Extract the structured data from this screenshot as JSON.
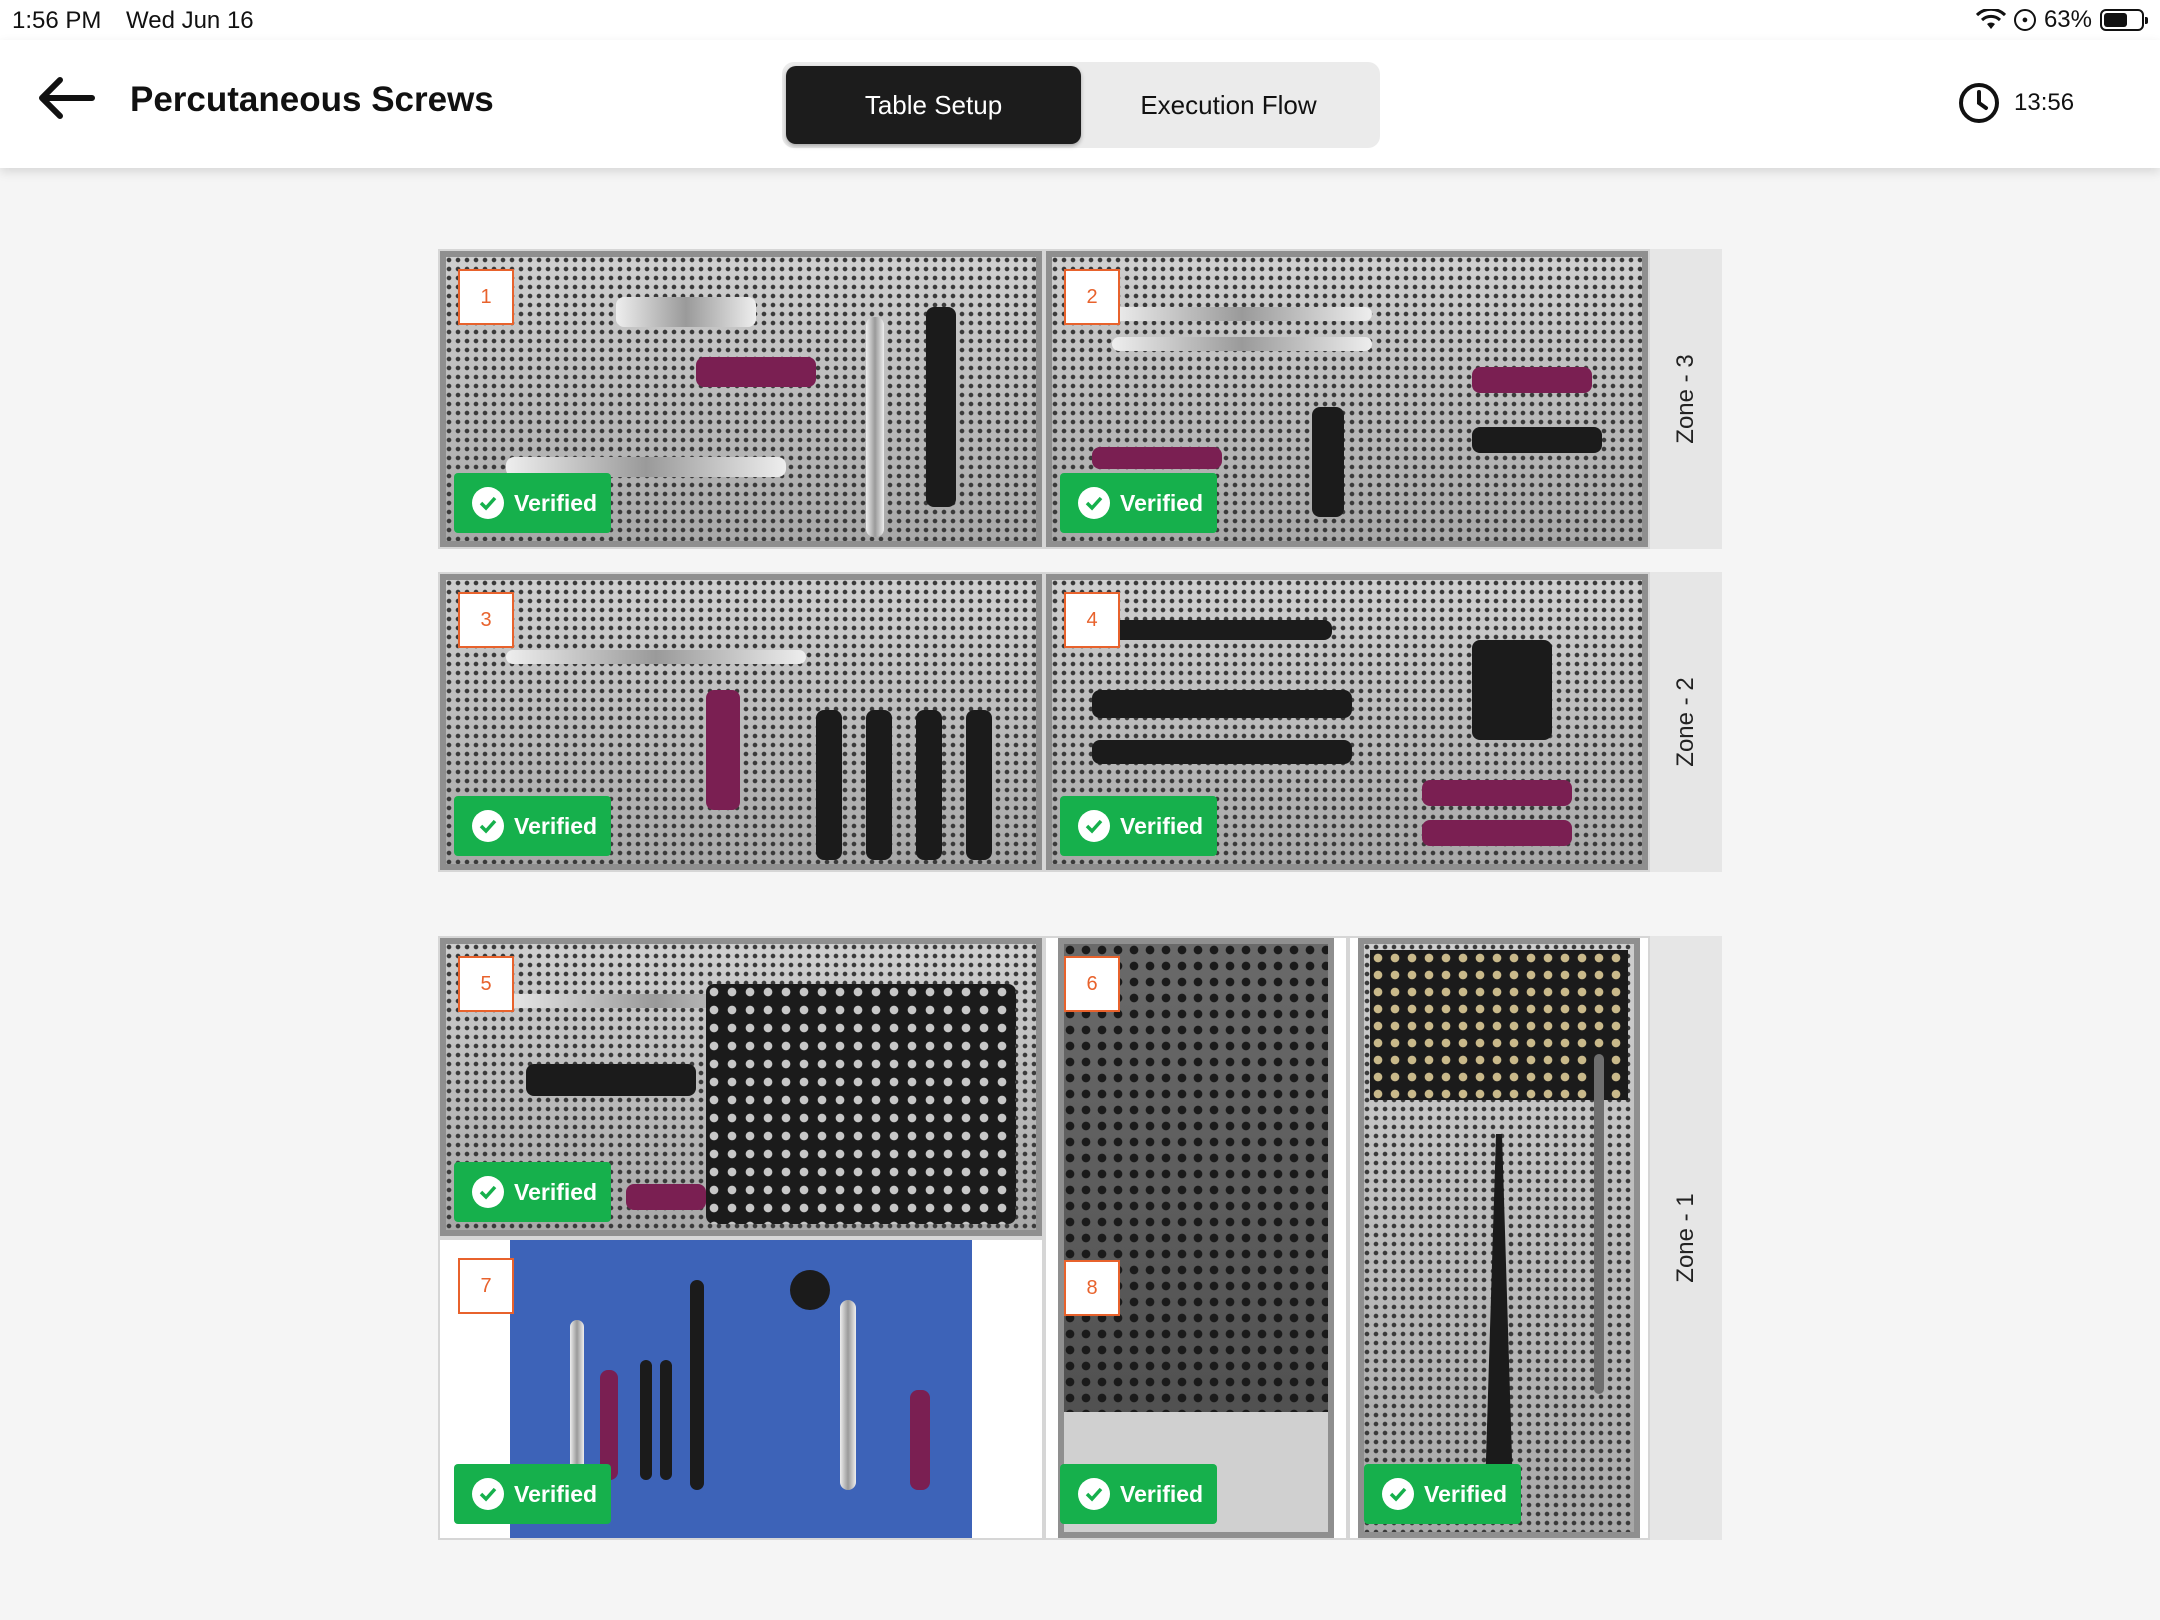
{
  "status_bar": {
    "time": "1:56 PM",
    "date": "Wed Jun 16",
    "battery": "63%",
    "battery_level": 0.63
  },
  "header": {
    "title": "Percutaneous Screws",
    "tabs": [
      {
        "label": "Table Setup",
        "active": true
      },
      {
        "label": "Execution Flow",
        "active": false
      }
    ],
    "timer": "13:56"
  },
  "zones": [
    {
      "label": "Zone - 3"
    },
    {
      "label": "Zone - 2"
    },
    {
      "label": "Zone - 1"
    }
  ],
  "trays": [
    {
      "number": "1",
      "status": "Verified"
    },
    {
      "number": "2",
      "status": "Verified"
    },
    {
      "number": "3",
      "status": "Verified"
    },
    {
      "number": "4",
      "status": "Verified"
    },
    {
      "number": "5",
      "status": "Verified"
    },
    {
      "number": "6",
      "status": ""
    },
    {
      "number": "7",
      "status": "Verified"
    },
    {
      "number": "8",
      "status": "Verified"
    },
    {
      "number": "",
      "status": "Verified"
    }
  ],
  "colors": {
    "verified": "#16b04c",
    "number_accent": "#e8622c",
    "active_tab": "#1c1c1c"
  }
}
